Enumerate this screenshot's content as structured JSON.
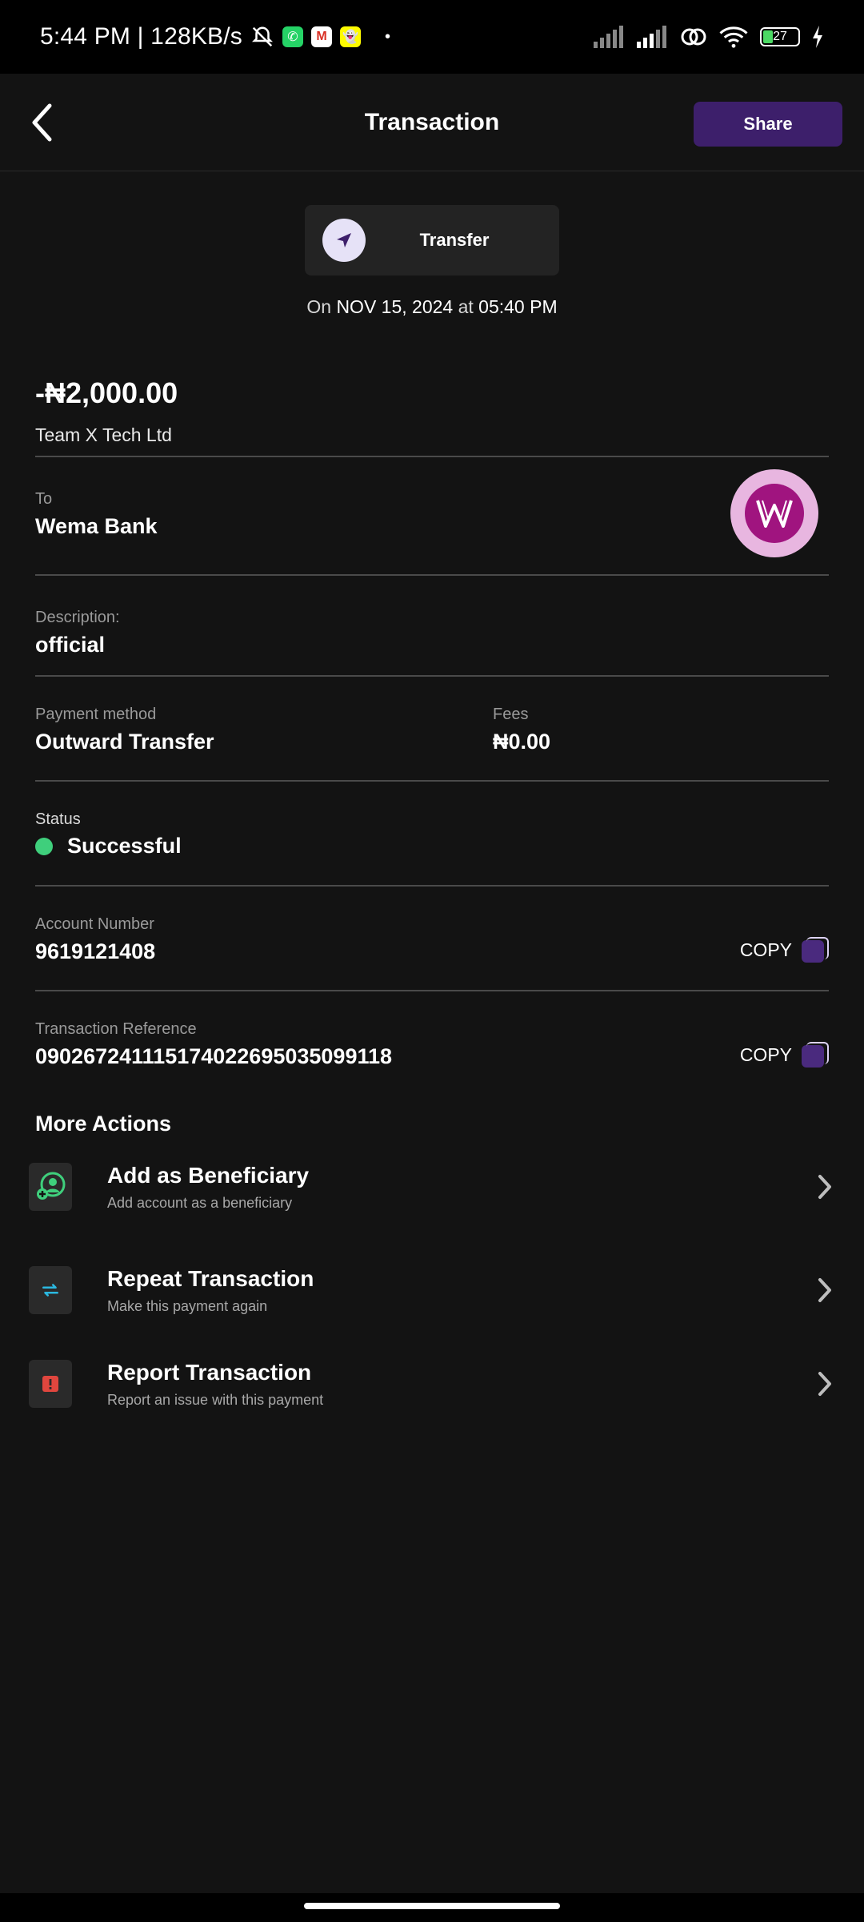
{
  "status_bar": {
    "time": "5:44 PM | 128KB/s",
    "battery": "27",
    "icons": [
      "bell-off-icon",
      "whatsapp-icon",
      "gmail-icon",
      "snapchat-icon",
      "signal-icon",
      "signal-icon",
      "link-icon",
      "wifi-icon",
      "battery-icon",
      "charging-icon"
    ]
  },
  "header": {
    "title": "Transaction",
    "share_label": "Share"
  },
  "transaction": {
    "type_label": "Transfer",
    "date_prefix": "On ",
    "date": "NOV 15, 2024",
    "date_mid": " at ",
    "time": "05:40 PM",
    "amount": "-₦2,000.00",
    "sender": "Team X Tech Ltd"
  },
  "details": {
    "to_label": "To",
    "to_value": "Wema Bank",
    "description_label": "Description:",
    "description_value": "official",
    "payment_method_label": "Payment method",
    "payment_method_value": "Outward Transfer",
    "fees_label": "Fees",
    "fees_value": "₦0.00",
    "status_label": "Status",
    "status_value": "Successful",
    "account_number_label": "Account Number",
    "account_number_value": "9619121408",
    "reference_label": "Transaction Reference",
    "reference_value": "090267241115174022695035099118",
    "copy_label": "COPY"
  },
  "more_actions": {
    "title": "More Actions",
    "items": [
      {
        "title": "Add as Beneficiary",
        "subtitle": "Add account as a beneficiary"
      },
      {
        "title": "Repeat Transaction",
        "subtitle": "Make this payment again"
      },
      {
        "title": "Report Transaction",
        "subtitle": "Report an issue with this payment"
      }
    ]
  },
  "colors": {
    "background": "#131313",
    "accent": "#3d1f6b",
    "success": "#3fcf7c",
    "report": "#e0463e",
    "repeat": "#2bb8e0",
    "beneficiary": "#3fcf7c"
  }
}
